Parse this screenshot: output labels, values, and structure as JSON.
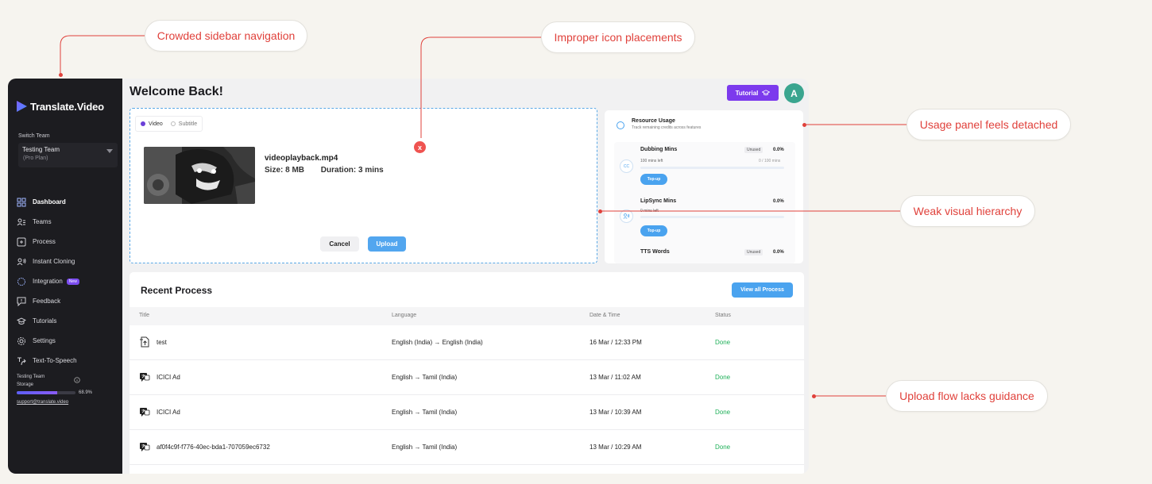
{
  "annotations": {
    "sidebar": "Crowded sidebar navigation",
    "icons": "Improper icon placements",
    "usage": "Usage panel feels detached",
    "hierarchy": "Weak visual hierarchy",
    "upload": "Upload flow lacks guidance"
  },
  "brand": {
    "name": "Translate.Video"
  },
  "sidebar": {
    "switch_team_label": "Switch Team",
    "team_name": "Testing Team",
    "team_plan": "(Pro Plan)",
    "items": [
      {
        "label": "Dashboard",
        "icon": "dashboard-icon"
      },
      {
        "label": "Teams",
        "icon": "teams-icon"
      },
      {
        "label": "Process",
        "icon": "process-icon"
      },
      {
        "label": "Instant Cloning",
        "icon": "voice-clone-icon"
      },
      {
        "label": "Integration",
        "icon": "integration-icon",
        "badge": "New"
      },
      {
        "label": "Feedback",
        "icon": "feedback-icon"
      },
      {
        "label": "Tutorials",
        "icon": "graduation-cap-icon"
      },
      {
        "label": "Settings",
        "icon": "gear-icon"
      },
      {
        "label": "Text-To-Speech",
        "icon": "text-to-speech-icon"
      }
    ],
    "storage": {
      "team": "Testing Team",
      "label": "Storage",
      "percent_text": "68.9%",
      "percent": 68.9
    },
    "support_email": "support@translate.video"
  },
  "header": {
    "title": "Welcome Back!",
    "tutorial_label": "Tutorial",
    "avatar_initial": "A"
  },
  "upload": {
    "tabs": [
      "Video",
      "Subtitle"
    ],
    "selected_tab": "Video",
    "file_name": "videoplayback.mp4",
    "size": "Size: 8 MB",
    "duration": "Duration: 3 mins",
    "remove_label": "x",
    "cancel_label": "Cancel",
    "upload_label": "Upload"
  },
  "usage": {
    "title": "Resource Usage",
    "subtitle": "Track remaining credits across features",
    "items": [
      {
        "name": "Dubbing Mins",
        "badge": "Unused",
        "percent": "0.0%",
        "left": "100 mins left",
        "ratio": "0 / 100 mins",
        "topup": "Top-up",
        "icon_label": "CC"
      },
      {
        "name": "LipSync Mins",
        "badge": "",
        "percent": "0.0%",
        "left": "0 mins left",
        "ratio": "",
        "topup": "Top-up",
        "icon_label": ""
      },
      {
        "name": "TTS Words",
        "badge": "Unused",
        "percent": "0.0%"
      }
    ]
  },
  "recent": {
    "title": "Recent Process",
    "view_all_label": "View all Process",
    "columns": [
      "Title",
      "Language",
      "Date & Time",
      "Status"
    ],
    "rows": [
      {
        "title": "test",
        "language": "English (India) → English (India)",
        "datetime": "16 Mar / 12:33 PM",
        "status": "Done"
      },
      {
        "title": "ICICI Ad",
        "language": "English → Tamil (India)",
        "datetime": "13 Mar / 11:02 AM",
        "status": "Done"
      },
      {
        "title": "ICICI Ad",
        "language": "English → Tamil (India)",
        "datetime": "13 Mar / 10:39 AM",
        "status": "Done"
      },
      {
        "title": "af0f4c9f-f776-40ec-bda1-707059ec6732",
        "language": "English → Tamil (India)",
        "datetime": "13 Mar / 10:29 AM",
        "status": "Done"
      }
    ]
  },
  "colors": {
    "accent_purple": "#7c3aed",
    "accent_blue": "#4aa3ef",
    "annotation_red": "#e0413b",
    "done_green": "#20b15a",
    "sidebar_bg": "#1c1c20"
  }
}
